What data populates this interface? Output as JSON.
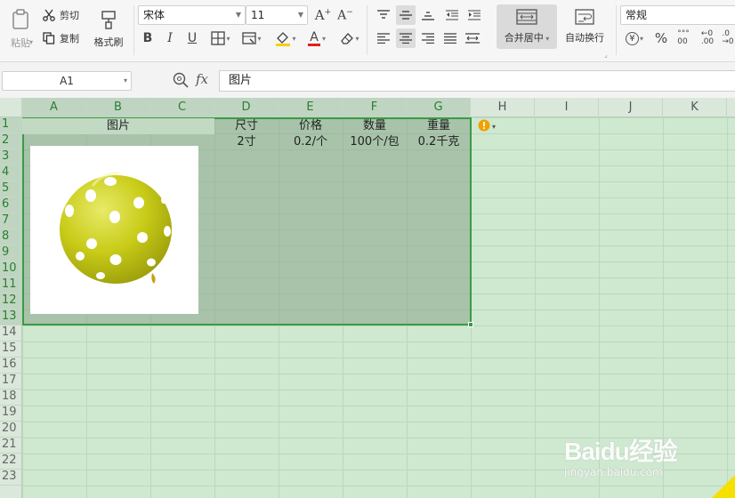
{
  "ribbon": {
    "paste": "粘贴",
    "cut": "剪切",
    "copy": "复制",
    "format_painter": "格式刷",
    "font_name": "宋体",
    "font_size": "11",
    "merge_center": "合并居中",
    "wrap_text": "自动换行",
    "number_format": "常规"
  },
  "formula_bar": {
    "name_box": "A1",
    "fx_label": "fx",
    "formula": "图片"
  },
  "columns": [
    "A",
    "B",
    "C",
    "D",
    "E",
    "F",
    "G",
    "H",
    "I",
    "J",
    "K"
  ],
  "rows": [
    "1",
    "2",
    "3",
    "4",
    "5",
    "6",
    "7",
    "8",
    "9",
    "10",
    "11",
    "12",
    "13",
    "14",
    "15",
    "16",
    "17",
    "18",
    "19",
    "20",
    "21",
    "22",
    "23"
  ],
  "sheet": {
    "headers": {
      "a1": "图片",
      "d1": "尺寸",
      "e1": "价格",
      "f1": "数量",
      "g1": "重量"
    },
    "row2": {
      "d2": "2寸",
      "e2": "0.2/个",
      "f2": "100个/包",
      "g2": "0.2千克"
    }
  },
  "picture": {
    "subject": "yellow-polka-dot-balloon",
    "balloon_color": "#c9cc18",
    "dot_color": "#ffffff"
  },
  "colors": {
    "grid_bg": "#cfe8d0",
    "selection_border": "#3a9a44",
    "warning_icon": "#f0a000"
  },
  "watermark": {
    "brand": "Baidu经验",
    "url": "jingyan.baidu.com"
  }
}
